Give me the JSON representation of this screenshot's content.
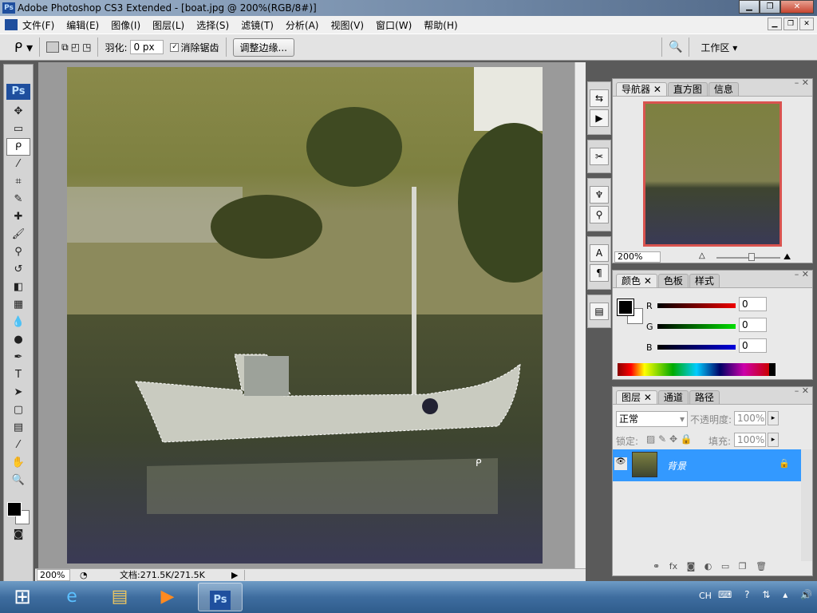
{
  "title": "Adobe Photoshop CS3 Extended - [boat.jpg @ 200%(RGB/8#)]",
  "app_icon": "Ps",
  "menu": [
    "文件(F)",
    "编辑(E)",
    "图像(I)",
    "图层(L)",
    "选择(S)",
    "滤镜(T)",
    "分析(A)",
    "视图(V)",
    "窗口(W)",
    "帮助(H)"
  ],
  "options": {
    "feather_label": "羽化:",
    "feather_value": "0 px",
    "antialias_label": "消除锯齿",
    "antialias_checked": true,
    "refine_edge": "调整边缘...",
    "workspace": "工作区 ▾"
  },
  "status": {
    "zoom": "200%",
    "doc": "文档:271.5K/271.5K"
  },
  "navigator": {
    "tabs": [
      "导航器",
      "直方图",
      "信息"
    ],
    "zoom": "200%",
    "slider_percent": 0.55
  },
  "color": {
    "tabs": [
      "颜色",
      "色板",
      "样式"
    ],
    "r_label": "R",
    "g_label": "G",
    "b_label": "B",
    "r": "0",
    "g": "0",
    "b": "0",
    "foreground": "#000000",
    "background": "#ffffff"
  },
  "layers": {
    "tabs": [
      "图层",
      "通道",
      "路径"
    ],
    "blend": "正常",
    "opacity_label": "不透明度:",
    "opacity": "100%",
    "lock_label": "锁定:",
    "fill_label": "填充:",
    "fill": "100%",
    "items": [
      {
        "name": "背景",
        "locked": true,
        "visible": true,
        "selected": true
      }
    ]
  },
  "taskbar": {
    "lang": "CH",
    "active_app": "Ps"
  },
  "colors": {
    "selection": "#3399ff",
    "nav_frame": "#d9534f"
  }
}
